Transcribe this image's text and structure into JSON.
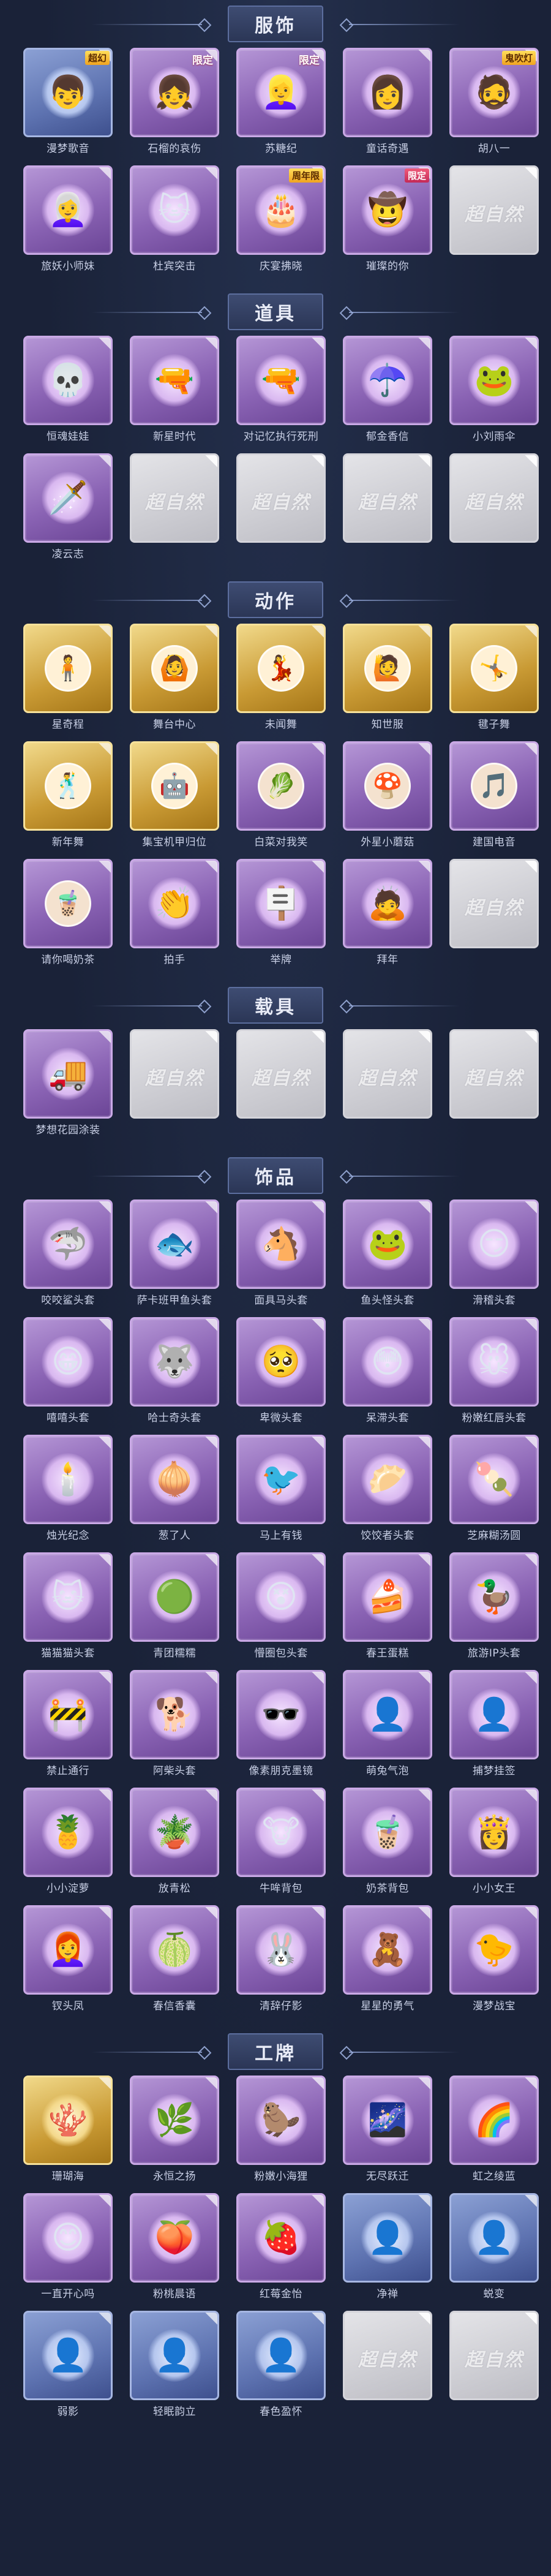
{
  "sections": [
    {
      "title": "服饰",
      "items": [
        {
          "label": "漫梦歌音",
          "style": "blue",
          "icon": "purple-hair-portrait-icon",
          "glyph": "👦",
          "tag": "超幻",
          "tag_style": "yellow"
        },
        {
          "label": "石榴的哀伤",
          "style": "purple",
          "icon": "grey-hair-girl-portrait-icon",
          "glyph": "👧",
          "tag": "限定",
          "tag_style": "tinted"
        },
        {
          "label": "苏糖纪",
          "style": "purple",
          "icon": "pink-hair-girl-portrait-icon",
          "glyph": "👱‍♀️",
          "tag": "限定",
          "tag_style": "tinted"
        },
        {
          "label": "童话奇遇",
          "style": "purple",
          "icon": "hat-girl-portrait-icon",
          "glyph": "👩",
          "tag": "",
          "tag_style": ""
        },
        {
          "label": "胡八一",
          "style": "purple",
          "icon": "explorer-portrait-icon",
          "glyph": "🧔",
          "tag": "鬼吹灯",
          "tag_style": "yellow"
        },
        {
          "label": "旅妖小师妹",
          "style": "purple",
          "icon": "silver-hair-girl-portrait-icon",
          "glyph": "👩‍🦳",
          "tag": "",
          "tag_style": ""
        },
        {
          "label": "杜宾突击",
          "style": "purple",
          "icon": "cat-ear-soldier-portrait-icon",
          "glyph": "🐱",
          "tag": "",
          "tag_style": ""
        },
        {
          "label": "庆宴拂晓",
          "style": "purple",
          "icon": "festival-girl-portrait-icon",
          "glyph": "🎂",
          "tag": "周年限",
          "tag_style": "yellow"
        },
        {
          "label": "璀璨的你",
          "style": "purple",
          "icon": "cowgirl-portrait-icon",
          "glyph": "🤠",
          "tag": "限定",
          "tag_style": ""
        },
        {
          "label": "",
          "style": "grey",
          "icon": "locked-placeholder-icon",
          "glyph": "",
          "tag": "",
          "tag_style": "",
          "placeholder": "超自然"
        }
      ]
    },
    {
      "title": "道具",
      "items": [
        {
          "label": "恒魂娃娃",
          "style": "purple",
          "icon": "skull-doll-icon",
          "glyph": "💀",
          "tag": "",
          "tag_style": ""
        },
        {
          "label": "新星时代",
          "style": "purple",
          "icon": "revolver-icon",
          "glyph": "🔫",
          "tag": "",
          "tag_style": ""
        },
        {
          "label": "对记忆执行死刑",
          "style": "purple",
          "icon": "energy-gun-icon",
          "glyph": "🔫",
          "tag": "",
          "tag_style": ""
        },
        {
          "label": "郁金香信",
          "style": "purple",
          "icon": "tulip-umbrella-icon",
          "glyph": "☂️",
          "tag": "",
          "tag_style": ""
        },
        {
          "label": "小刘雨伞",
          "style": "purple",
          "icon": "frog-umbrella-icon",
          "glyph": "🐸",
          "tag": "",
          "tag_style": ""
        },
        {
          "label": "凌云志",
          "style": "purple",
          "icon": "sword-icon",
          "glyph": "🗡️",
          "tag": "",
          "tag_style": ""
        },
        {
          "label": "",
          "style": "grey",
          "icon": "locked-placeholder-icon",
          "glyph": "",
          "tag": "",
          "tag_style": "",
          "placeholder": "超自然"
        },
        {
          "label": "",
          "style": "grey",
          "icon": "locked-placeholder-icon",
          "glyph": "",
          "tag": "",
          "tag_style": "",
          "placeholder": "超自然"
        },
        {
          "label": "",
          "style": "grey",
          "icon": "locked-placeholder-icon",
          "glyph": "",
          "tag": "",
          "tag_style": "",
          "placeholder": "超自然"
        },
        {
          "label": "",
          "style": "grey",
          "icon": "locked-placeholder-icon",
          "glyph": "",
          "tag": "",
          "tag_style": "",
          "placeholder": "超自然"
        }
      ]
    },
    {
      "title": "动作",
      "items": [
        {
          "label": "星奇程",
          "style": "gold",
          "icon": "pose-icon",
          "glyph": "🧍",
          "pose": true
        },
        {
          "label": "舞台中心",
          "style": "gold",
          "icon": "pose-icon",
          "glyph": "🙆",
          "pose": true
        },
        {
          "label": "未闻舞",
          "style": "gold",
          "icon": "pose-icon",
          "glyph": "💃",
          "pose": true
        },
        {
          "label": "知世服",
          "style": "gold",
          "icon": "pose-icon",
          "glyph": "🙋",
          "pose": true
        },
        {
          "label": "毽子舞",
          "style": "gold",
          "icon": "pose-icon",
          "glyph": "🤸",
          "pose": true
        },
        {
          "label": "新年舞",
          "style": "gold",
          "icon": "pose-icon",
          "glyph": "🕺",
          "pose": true
        },
        {
          "label": "集宝机甲归位",
          "style": "gold",
          "icon": "pose-icon",
          "glyph": "🤖",
          "pose": true
        },
        {
          "label": "白菜对我笑",
          "style": "purple",
          "icon": "pose-icon",
          "glyph": "🥬",
          "pose": true
        },
        {
          "label": "外星小蘑菇",
          "style": "purple",
          "icon": "pose-icon",
          "glyph": "🍄",
          "pose": true
        },
        {
          "label": "建国电音",
          "style": "purple",
          "icon": "pose-icon",
          "glyph": "🎵",
          "pose": true
        },
        {
          "label": "请你喝奶茶",
          "style": "purple",
          "icon": "pose-icon",
          "glyph": "🧋",
          "pose": true
        },
        {
          "label": "拍手",
          "style": "purple",
          "icon": "clap-pose-icon",
          "glyph": "👏",
          "tag": "",
          "tag_style": ""
        },
        {
          "label": "举牌",
          "style": "purple",
          "icon": "sign-pose-icon",
          "glyph": "🪧",
          "tag": "",
          "tag_style": ""
        },
        {
          "label": "拜年",
          "style": "purple",
          "icon": "bow-pose-icon",
          "glyph": "🙇",
          "tag": "",
          "tag_style": ""
        },
        {
          "label": "",
          "style": "grey",
          "icon": "locked-placeholder-icon",
          "glyph": "",
          "tag": "",
          "tag_style": "",
          "placeholder": "超自然"
        }
      ]
    },
    {
      "title": "载具",
      "items": [
        {
          "label": "梦想花园涂装",
          "style": "purple",
          "icon": "ice-cream-truck-icon",
          "glyph": "🚚",
          "tag": "",
          "tag_style": ""
        },
        {
          "label": "",
          "style": "grey",
          "icon": "locked-placeholder-icon",
          "glyph": "",
          "tag": "",
          "tag_style": "",
          "placeholder": "超自然"
        },
        {
          "label": "",
          "style": "grey",
          "icon": "locked-placeholder-icon",
          "glyph": "",
          "tag": "",
          "tag_style": "",
          "placeholder": "超自然"
        },
        {
          "label": "",
          "style": "grey",
          "icon": "locked-placeholder-icon",
          "glyph": "",
          "tag": "",
          "tag_style": "",
          "placeholder": "超自然"
        },
        {
          "label": "",
          "style": "grey",
          "icon": "locked-placeholder-icon",
          "glyph": "",
          "tag": "",
          "tag_style": "",
          "placeholder": "超自然"
        }
      ]
    },
    {
      "title": "饰品",
      "items": [
        {
          "label": "咬咬鲨头套",
          "style": "purple",
          "icon": "shark-head-icon",
          "glyph": "🦈"
        },
        {
          "label": "萨卡班甲鱼头套",
          "style": "purple",
          "icon": "fish-head-icon",
          "glyph": "🐟"
        },
        {
          "label": "面具马头套",
          "style": "purple",
          "icon": "horse-head-icon",
          "glyph": "🐴"
        },
        {
          "label": "鱼头怪头套",
          "style": "purple",
          "icon": "fish-monster-head-icon",
          "glyph": "🐸"
        },
        {
          "label": "滑稽头套",
          "style": "purple",
          "icon": "smirk-face-icon",
          "glyph": "😏"
        },
        {
          "label": "嘻嘻头套",
          "style": "purple",
          "icon": "grin-face-icon",
          "glyph": "😁"
        },
        {
          "label": "哈士奇头套",
          "style": "purple",
          "icon": "husky-head-icon",
          "glyph": "🐺"
        },
        {
          "label": "卑微头套",
          "style": "purple",
          "icon": "humble-face-icon",
          "glyph": "🥺"
        },
        {
          "label": "呆滞头套",
          "style": "purple",
          "icon": "dazed-face-icon",
          "glyph": "😳"
        },
        {
          "label": "粉嫩红唇头套",
          "style": "purple",
          "icon": "pikachu-head-icon",
          "glyph": "🐭"
        },
        {
          "label": "烛光纪念",
          "style": "purple",
          "icon": "candle-icon",
          "glyph": "🕯️"
        },
        {
          "label": "葱了人",
          "style": "purple",
          "icon": "onion-icon",
          "glyph": "🧅"
        },
        {
          "label": "马上有钱",
          "style": "purple",
          "icon": "lucky-bird-icon",
          "glyph": "🐦"
        },
        {
          "label": "饺饺者头套",
          "style": "purple",
          "icon": "dumpling-icon",
          "glyph": "🥟"
        },
        {
          "label": "芝麻糊汤圆",
          "style": "purple",
          "icon": "rice-ball-icon",
          "glyph": "🍡"
        },
        {
          "label": "猫猫猫头套",
          "style": "purple",
          "icon": "cat-head-icon",
          "glyph": "🐱"
        },
        {
          "label": "青团糯糯",
          "style": "purple",
          "icon": "green-rice-ball-icon",
          "glyph": "🟢"
        },
        {
          "label": "懵圈包头套",
          "style": "purple",
          "icon": "confused-face-icon",
          "glyph": "😵"
        },
        {
          "label": "春王蛋糕",
          "style": "purple",
          "icon": "roll-cake-icon",
          "glyph": "🍰"
        },
        {
          "label": "旅游IP头套",
          "style": "purple",
          "icon": "duck-head-icon",
          "glyph": "🦆"
        },
        {
          "label": "禁止通行",
          "style": "purple",
          "icon": "traffic-cone-icon",
          "glyph": "🚧"
        },
        {
          "label": "阿柴头套",
          "style": "purple",
          "icon": "shiba-head-icon",
          "glyph": "🐕"
        },
        {
          "label": "像素朋克墨镜",
          "style": "purple",
          "icon": "pixel-sunglasses-icon",
          "glyph": "🕶️"
        },
        {
          "label": "萌兔气泡",
          "style": "purple",
          "icon": "silhouette-icon",
          "glyph": "👤"
        },
        {
          "label": "捕梦挂签",
          "style": "purple",
          "icon": "silhouette-icon",
          "glyph": "👤"
        },
        {
          "label": "小小淀萝",
          "style": "purple",
          "icon": "pineapple-doll-icon",
          "glyph": "🍍"
        },
        {
          "label": "放青松",
          "style": "purple",
          "icon": "bonsai-icon",
          "glyph": "🪴"
        },
        {
          "label": "牛哞背包",
          "style": "purple",
          "icon": "cow-backpack-icon",
          "glyph": "🐮"
        },
        {
          "label": "奶茶背包",
          "style": "purple",
          "icon": "milk-tea-backpack-icon",
          "glyph": "🧋"
        },
        {
          "label": "小小女王",
          "style": "purple",
          "icon": "little-queen-icon",
          "glyph": "👸"
        },
        {
          "label": "钗头凤",
          "style": "purple",
          "icon": "phoenix-hairpin-icon",
          "glyph": "👩‍🦰"
        },
        {
          "label": "春信香囊",
          "style": "purple",
          "icon": "sachet-icon",
          "glyph": "🍈"
        },
        {
          "label": "清辞仔影",
          "style": "purple",
          "icon": "bunny-doll-icon",
          "glyph": "🐰"
        },
        {
          "label": "星星的勇气",
          "style": "purple",
          "icon": "star-charm-icon",
          "glyph": "🧸"
        },
        {
          "label": "漫梦战宝",
          "style": "purple",
          "icon": "battle-doll-icon",
          "glyph": "🐤"
        }
      ]
    },
    {
      "title": "工牌",
      "items": [
        {
          "label": "珊瑚海",
          "style": "gold",
          "icon": "coral-sea-badge-icon",
          "glyph": "🪸"
        },
        {
          "label": "永恒之扬",
          "style": "purple",
          "icon": "eternal-badge-icon",
          "glyph": "🌿"
        },
        {
          "label": "粉嫩小海狸",
          "style": "purple",
          "icon": "beaver-badge-icon",
          "glyph": "🦫"
        },
        {
          "label": "无尽跃迁",
          "style": "purple",
          "icon": "galaxy-badge-icon",
          "glyph": "🌌"
        },
        {
          "label": "虹之绫蓝",
          "style": "purple",
          "icon": "rainbow-badge-icon",
          "glyph": "🌈"
        },
        {
          "label": "一直开心吗",
          "style": "purple",
          "icon": "happy-badge-icon",
          "glyph": "😊"
        },
        {
          "label": "粉桃晨语",
          "style": "purple",
          "icon": "peach-badge-icon",
          "glyph": "🍑"
        },
        {
          "label": "红莓金怡",
          "style": "purple",
          "icon": "strawberry-badge-icon",
          "glyph": "🍓"
        },
        {
          "label": "净禅",
          "style": "blue",
          "icon": "silhouette-badge-icon",
          "glyph": "👤"
        },
        {
          "label": "蜕变",
          "style": "blue",
          "icon": "silhouette-badge-icon",
          "glyph": "👤"
        },
        {
          "label": "弱影",
          "style": "blue",
          "icon": "silhouette-badge-icon",
          "glyph": "👤"
        },
        {
          "label": "轻眠韵立",
          "style": "blue",
          "icon": "silhouette-badge-icon",
          "glyph": "👤"
        },
        {
          "label": "春色盈怀",
          "style": "blue",
          "icon": "silhouette-badge-icon",
          "glyph": "👤"
        },
        {
          "label": "",
          "style": "grey",
          "icon": "locked-placeholder-icon",
          "glyph": "",
          "placeholder": "超自然"
        },
        {
          "label": "",
          "style": "grey",
          "icon": "locked-placeholder-icon",
          "glyph": "",
          "placeholder": "超自然"
        }
      ]
    }
  ]
}
